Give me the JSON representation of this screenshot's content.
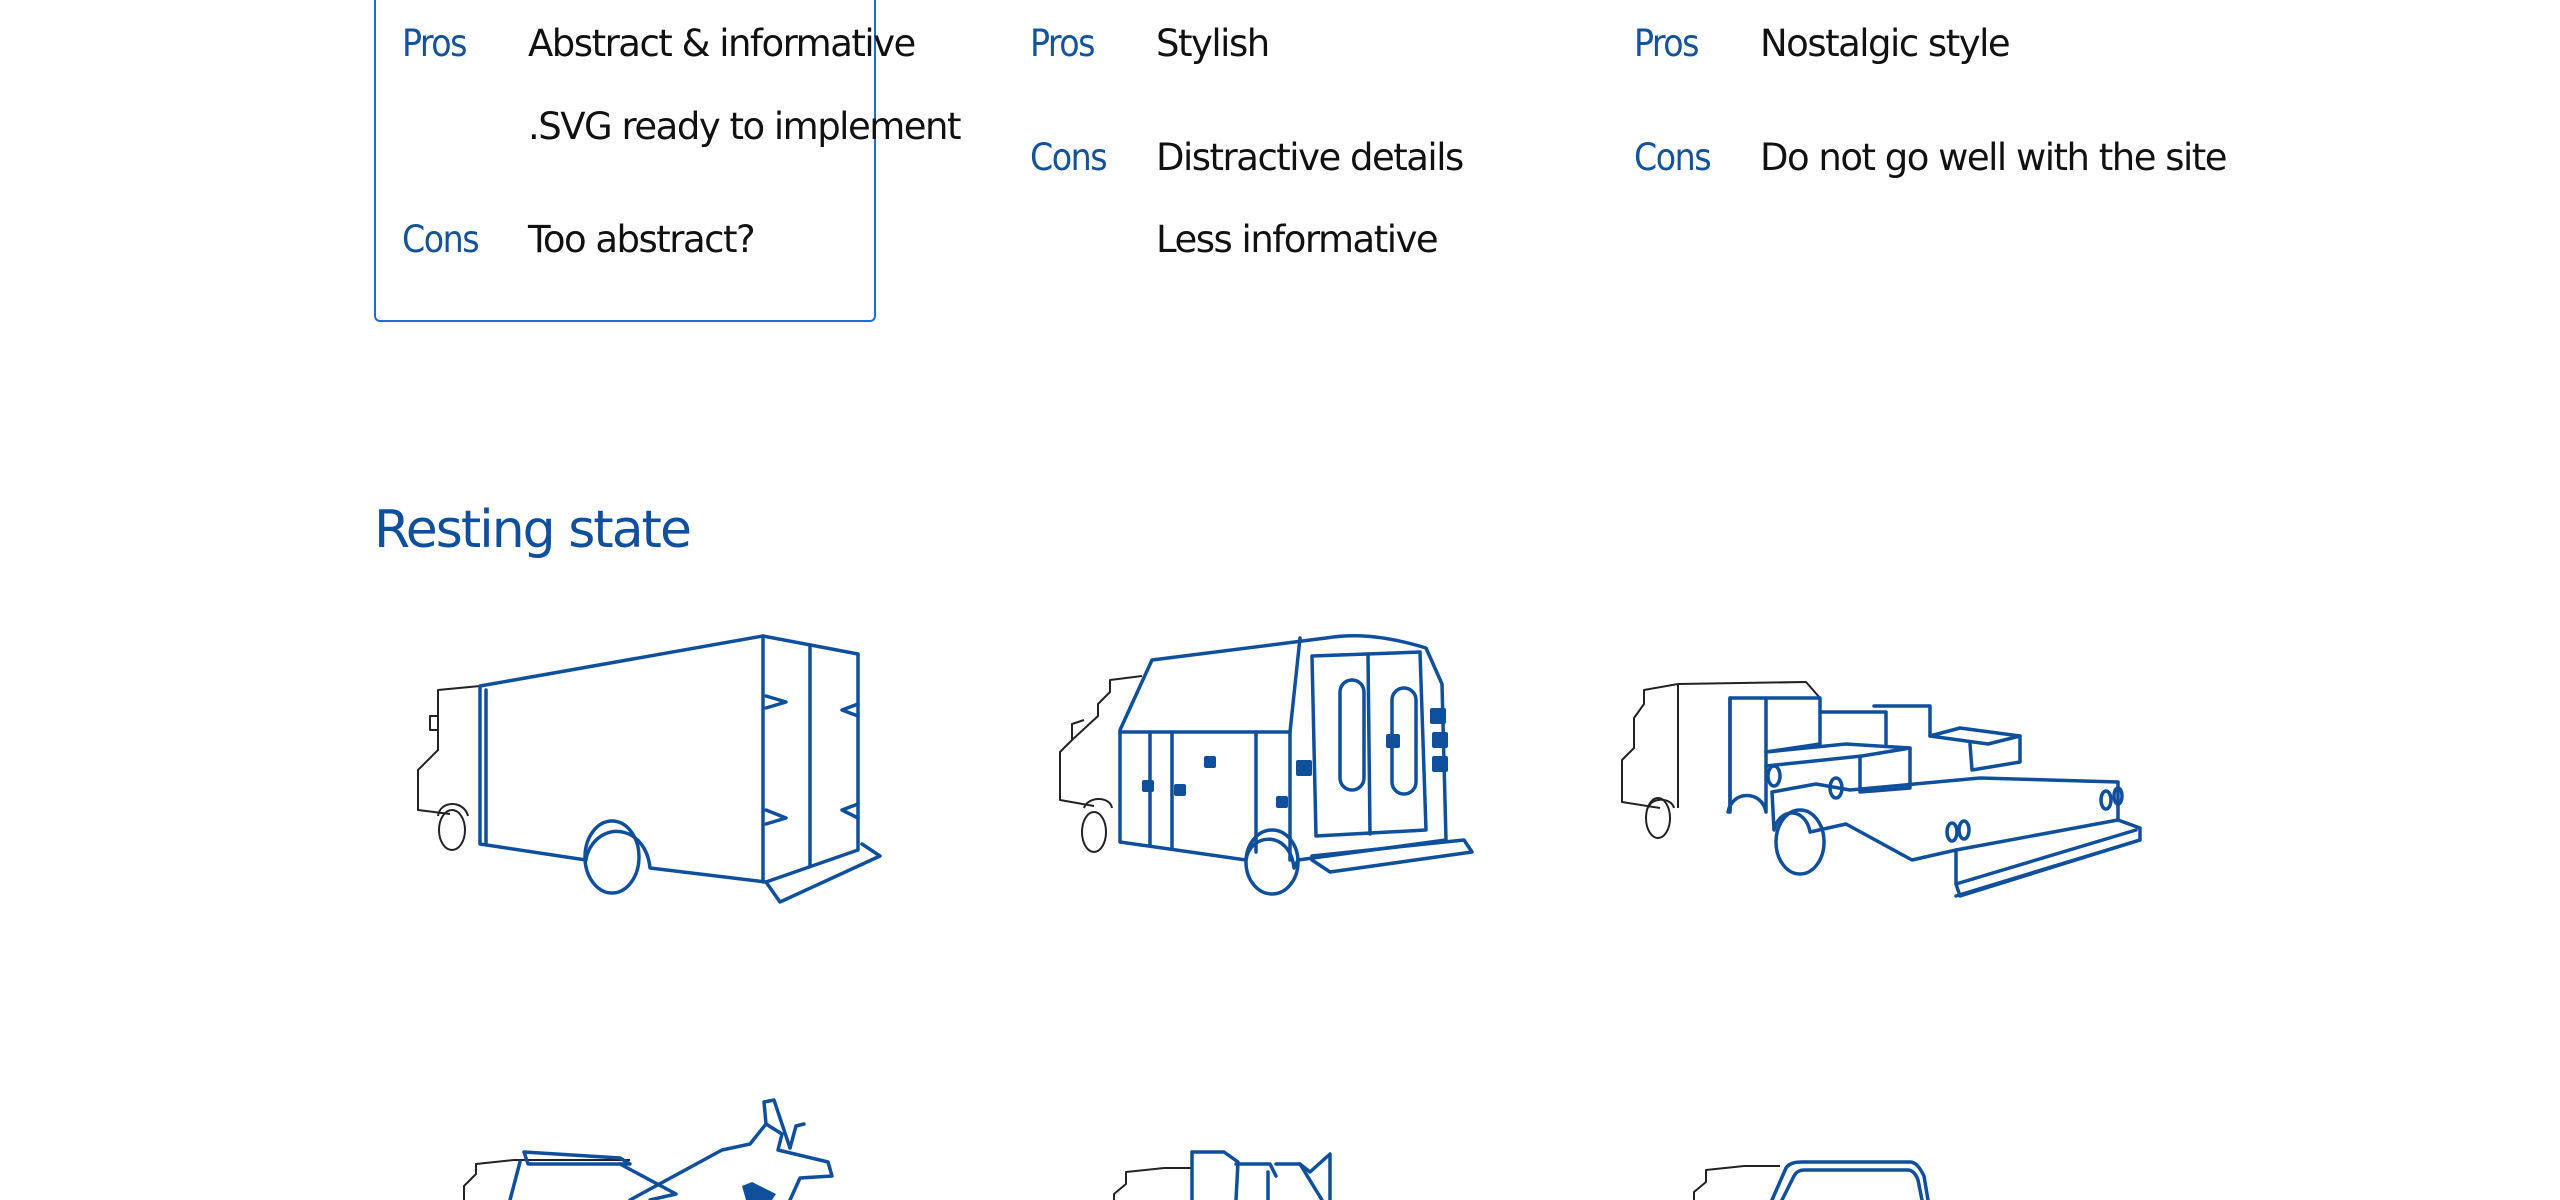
{
  "options": [
    {
      "selected": true,
      "pros_label": "Pros",
      "cons_label": "Cons",
      "pros": [
        "Abstract & informative",
        ".SVG ready to implement"
      ],
      "cons": [
        "Too abstract?"
      ]
    },
    {
      "selected": false,
      "pros_label": "Pros",
      "cons_label": "Cons",
      "pros": [
        "Stylish"
      ],
      "cons": [
        "Distractive details",
        "Less informative"
      ]
    },
    {
      "selected": false,
      "pros_label": "Pros",
      "cons_label": "Cons",
      "pros": [
        "Nostalgic style"
      ],
      "cons": [
        "Do not go well with the site"
      ]
    }
  ],
  "resting_state": {
    "title": "Resting state",
    "icons": [
      {
        "icon": "box-truck-icon"
      },
      {
        "icon": "service-van-icon"
      },
      {
        "icon": "flatbed-truck-icon"
      },
      {
        "icon": "crane-truck-icon"
      },
      {
        "icon": "dump-truck-icon"
      },
      {
        "icon": "van-icon"
      }
    ]
  },
  "colors": {
    "accent": "#0f4f9c",
    "selection_border": "#1f6bd0",
    "text": "#111111"
  }
}
